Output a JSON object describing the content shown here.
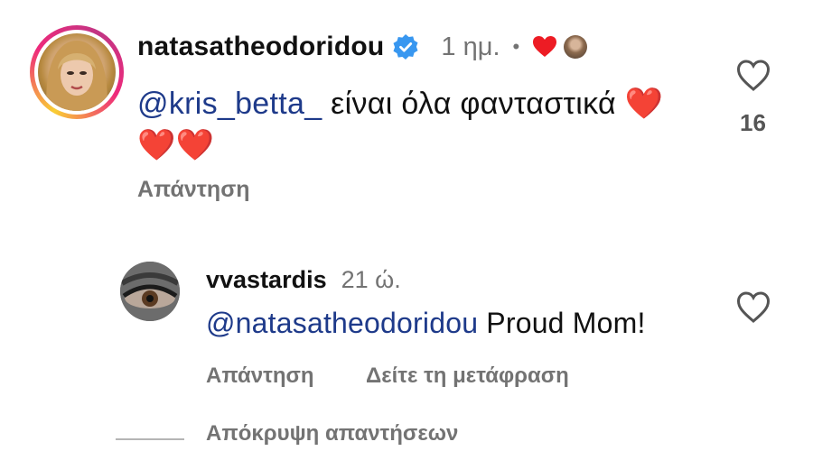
{
  "comment1": {
    "username": "natasatheodoridou",
    "time": "1 ημ.",
    "separator": "•",
    "mention": "@kris_betta_",
    "text": " είναι όλα φανταστικά ",
    "emoji_inline": "❤️",
    "emoji_line2": "❤️❤️",
    "reply_label": "Απάντηση",
    "like_count": "16"
  },
  "comment2": {
    "username": "vvastardis",
    "time": "21 ώ.",
    "mention": "@natasatheodoridou",
    "text": " Proud Mom!",
    "reply_label": "Απάντηση",
    "translate_label": "Δείτε τη μετάφραση"
  },
  "hide_replies_label": "Απόκρυψη απαντήσεων",
  "colors": {
    "mention": "#1e3a8a",
    "muted": "#737373",
    "verified": "#3897f0",
    "heart": "#ed1c24"
  }
}
